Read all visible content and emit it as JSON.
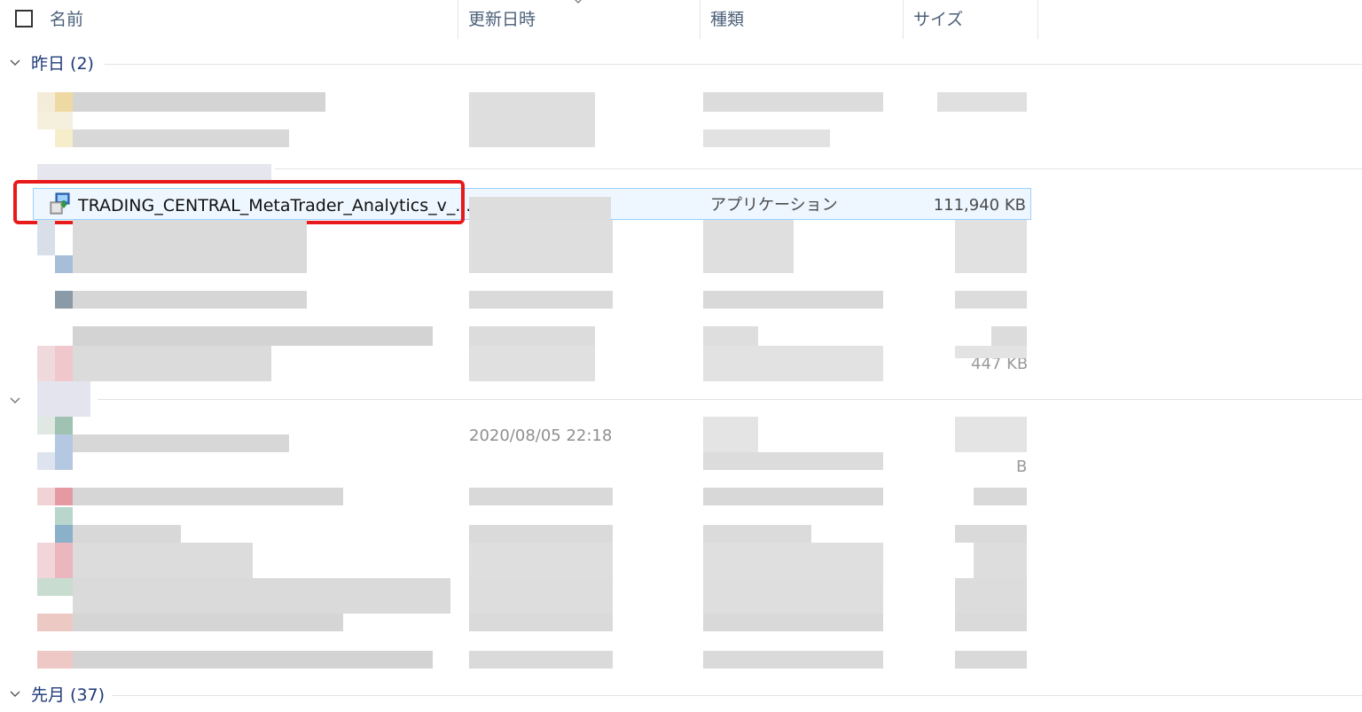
{
  "header": {
    "col_name": "名前",
    "col_date": "更新日時",
    "col_type": "種類",
    "col_size": "サイズ"
  },
  "groups": [
    {
      "label": "昨日 (2)"
    },
    {
      "label": "先月 (37)"
    }
  ],
  "highlighted_file": {
    "name": "TRADING_CENTRAL_MetaTrader_Analytics_v_...",
    "type": "アプリケーション",
    "size": "111,940 KB",
    "icon": "installer-icon"
  },
  "visible_fragments": {
    "date_fragment": "2020/08/05 22:18",
    "size_fragment_1": "447 KB",
    "size_fragment_2": "B"
  },
  "colors": {
    "header_text": "#4c607a",
    "group_text": "#1e3a78",
    "selection_border": "#99d1ff",
    "annotation_red": "#e8191b"
  }
}
